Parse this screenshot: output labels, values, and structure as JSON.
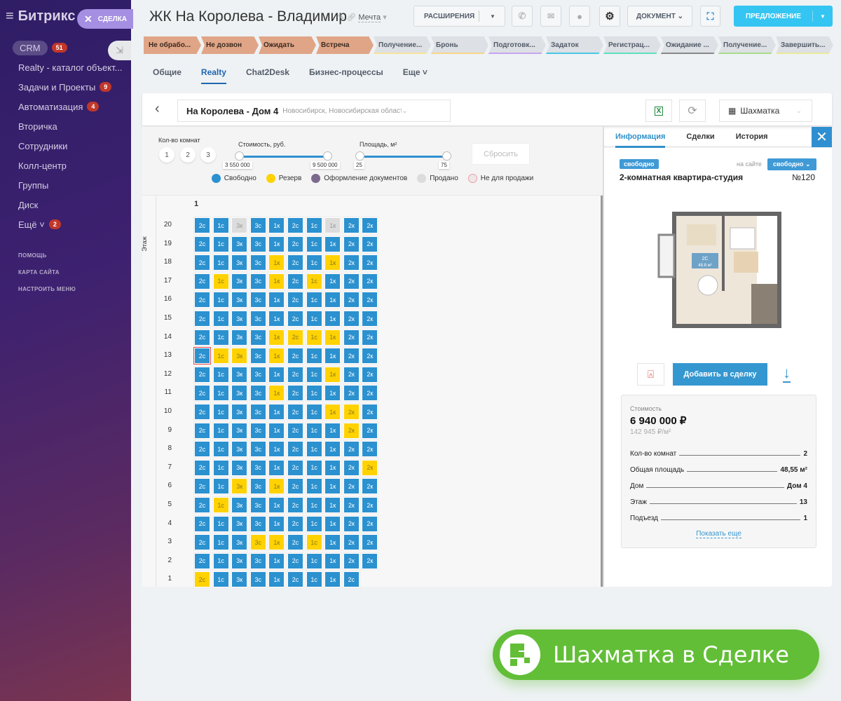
{
  "sidebar": {
    "logo": "Битрикс 24",
    "deal_pill": "СДЕЛКА",
    "items": [
      {
        "label": "CRM",
        "badge": "51"
      },
      {
        "label": "Realty - каталог объект...",
        "badge": null
      },
      {
        "label": "Задачи и Проекты",
        "badge": "9"
      },
      {
        "label": "Автоматизация",
        "badge": "4"
      },
      {
        "label": "Вторичка",
        "badge": null
      },
      {
        "label": "Сотрудники",
        "badge": null
      },
      {
        "label": "Колл-центр",
        "badge": null
      },
      {
        "label": "Группы",
        "badge": null
      },
      {
        "label": "Диск",
        "badge": null
      },
      {
        "label": "Ещё ˅",
        "badge": "2"
      }
    ],
    "links": [
      "ПОМОЩЬ",
      "КАРТА САЙТА",
      "НАСТРОИТЬ МЕНЮ"
    ]
  },
  "header": {
    "title": "ЖК На Королева - Владимир",
    "funnel": "Мечта",
    "extensions": "РАСШИРЕНИЯ",
    "document": "ДОКУМЕНТ",
    "proposal": "ПРЕДЛОЖЕНИЕ"
  },
  "stages": [
    {
      "label": "Не обрабо...",
      "color": "#e0a587",
      "done": true
    },
    {
      "label": "Не дозвон",
      "color": "#e0a587",
      "done": true
    },
    {
      "label": "Ожидать",
      "color": "#e0a587",
      "done": true
    },
    {
      "label": "Встреча",
      "color": "#e0a587",
      "done": true
    },
    {
      "label": "Получение...",
      "color": "#f7e49a",
      "done": false
    },
    {
      "label": "Бронь",
      "color": "#f7d58a",
      "done": false
    },
    {
      "label": "Подготовк...",
      "color": "#c7a5f0",
      "done": false
    },
    {
      "label": "Задаток",
      "color": "#47c8e6",
      "done": false
    },
    {
      "label": "Регистрац...",
      "color": "#5fe0c0",
      "done": false
    },
    {
      "label": "Ожидание ...",
      "color": "#888888",
      "done": false
    },
    {
      "label": "Получение...",
      "color": "#a7dc8a",
      "done": false
    },
    {
      "label": "Завершить...",
      "color": "#e8ec9a",
      "done": false
    }
  ],
  "tabs": [
    {
      "label": "Общие",
      "active": false
    },
    {
      "label": "Realty",
      "active": true
    },
    {
      "label": "Chat2Desk",
      "active": false
    },
    {
      "label": "Бизнес-процессы",
      "active": false
    },
    {
      "label": "Еще ˅",
      "active": false
    }
  ],
  "building": {
    "name": "На Королева - Дом 4",
    "address": "Новосибирск, Новосибирская область переулок",
    "view": "Шахматка"
  },
  "filters": {
    "rooms_label": "Кол-во комнат",
    "rooms": [
      "1",
      "2",
      "3"
    ],
    "price_label": "Стоимость, руб.",
    "price_min": "3 550 000",
    "price_max": "9 500 000",
    "area_label": "Площадь, м²",
    "area_min": "25",
    "area_max": "75",
    "reset": "Сбросить"
  },
  "legend": [
    {
      "label": "Свободно",
      "color": "#2b91cf"
    },
    {
      "label": "Резерв",
      "color": "#ffd200"
    },
    {
      "label": "Оформление документов",
      "color": "#7c6a8e"
    },
    {
      "label": "Продано",
      "color": "#dcdcdc"
    },
    {
      "label": "Не для продажи",
      "color": "#f0e6e8"
    }
  ],
  "grid": {
    "entrance": "1",
    "floor_axis": "Этаж",
    "selected": {
      "floor": "13",
      "index": 0
    },
    "floors": [
      {
        "floor": "20",
        "labels": [
          "2с",
          "1с",
          "3к",
          "3с",
          "1к",
          "2с",
          "1с",
          "1к",
          "2к",
          "2к"
        ],
        "status": [
          "free",
          "free",
          "sold",
          "free",
          "free",
          "free",
          "free",
          "sold",
          "free",
          "free"
        ]
      },
      {
        "floor": "19",
        "labels": [
          "2с",
          "1с",
          "3к",
          "3с",
          "1к",
          "2с",
          "1с",
          "1к",
          "2к",
          "2к"
        ],
        "status": [
          "free",
          "free",
          "free",
          "free",
          "free",
          "free",
          "free",
          "free",
          "free",
          "free"
        ]
      },
      {
        "floor": "18",
        "labels": [
          "2с",
          "1с",
          "3к",
          "3с",
          "1к",
          "2с",
          "1с",
          "1к",
          "2к",
          "2к"
        ],
        "status": [
          "free",
          "free",
          "free",
          "free",
          "reserve",
          "free",
          "free",
          "reserve",
          "free",
          "free"
        ]
      },
      {
        "floor": "17",
        "labels": [
          "2с",
          "1с",
          "3к",
          "3с",
          "1к",
          "2с",
          "1с",
          "1к",
          "2к",
          "2к"
        ],
        "status": [
          "free",
          "reserve",
          "free",
          "free",
          "reserve",
          "free",
          "reserve",
          "free",
          "free",
          "free"
        ]
      },
      {
        "floor": "16",
        "labels": [
          "2с",
          "1с",
          "3к",
          "3с",
          "1к",
          "2с",
          "1с",
          "1к",
          "2к",
          "2к"
        ],
        "status": [
          "free",
          "free",
          "free",
          "free",
          "free",
          "free",
          "free",
          "free",
          "free",
          "free"
        ]
      },
      {
        "floor": "15",
        "labels": [
          "2с",
          "1с",
          "3к",
          "3с",
          "1к",
          "2с",
          "1с",
          "1к",
          "2к",
          "2к"
        ],
        "status": [
          "free",
          "free",
          "free",
          "free",
          "free",
          "free",
          "free",
          "free",
          "free",
          "free"
        ]
      },
      {
        "floor": "14",
        "labels": [
          "2с",
          "1с",
          "3к",
          "3с",
          "1к",
          "2с",
          "1с",
          "1к",
          "2к",
          "2к"
        ],
        "status": [
          "free",
          "free",
          "free",
          "free",
          "reserve",
          "reserve",
          "reserve",
          "reserve",
          "free",
          "free"
        ]
      },
      {
        "floor": "13",
        "labels": [
          "2с",
          "1с",
          "3к",
          "3с",
          "1к",
          "2с",
          "1с",
          "1к",
          "2к",
          "2к"
        ],
        "status": [
          "free",
          "reserve",
          "reserve",
          "free",
          "reserve",
          "free",
          "free",
          "free",
          "free",
          "free"
        ]
      },
      {
        "floor": "12",
        "labels": [
          "2с",
          "1с",
          "3к",
          "3с",
          "1к",
          "2с",
          "1с",
          "1к",
          "2к",
          "2к"
        ],
        "status": [
          "free",
          "free",
          "free",
          "free",
          "free",
          "free",
          "free",
          "reserve",
          "free",
          "free"
        ]
      },
      {
        "floor": "11",
        "labels": [
          "2с",
          "1с",
          "3к",
          "3с",
          "1к",
          "2с",
          "1с",
          "1к",
          "2к",
          "2к"
        ],
        "status": [
          "free",
          "free",
          "free",
          "free",
          "reserve",
          "free",
          "free",
          "free",
          "free",
          "free"
        ]
      },
      {
        "floor": "10",
        "labels": [
          "2с",
          "1с",
          "3к",
          "3с",
          "1к",
          "2с",
          "1с",
          "1к",
          "2к",
          "2к"
        ],
        "status": [
          "free",
          "free",
          "free",
          "free",
          "free",
          "free",
          "free",
          "reserve",
          "reserve",
          "free"
        ]
      },
      {
        "floor": "9",
        "labels": [
          "2с",
          "1с",
          "3к",
          "3с",
          "1к",
          "2с",
          "1с",
          "1к",
          "2к",
          "2к"
        ],
        "status": [
          "free",
          "free",
          "free",
          "free",
          "free",
          "free",
          "free",
          "free",
          "reserve",
          "free"
        ]
      },
      {
        "floor": "8",
        "labels": [
          "2с",
          "1с",
          "3к",
          "3с",
          "1к",
          "2с",
          "1с",
          "1к",
          "2к",
          "2к"
        ],
        "status": [
          "free",
          "free",
          "free",
          "free",
          "free",
          "free",
          "free",
          "free",
          "free",
          "free"
        ]
      },
      {
        "floor": "7",
        "labels": [
          "2с",
          "1с",
          "3к",
          "3с",
          "1к",
          "2с",
          "1с",
          "1к",
          "2к",
          "2к"
        ],
        "status": [
          "free",
          "free",
          "free",
          "free",
          "free",
          "free",
          "free",
          "free",
          "free",
          "reserve"
        ]
      },
      {
        "floor": "6",
        "labels": [
          "2с",
          "1с",
          "3к",
          "3с",
          "1к",
          "2с",
          "1с",
          "1к",
          "2к",
          "2к"
        ],
        "status": [
          "free",
          "free",
          "reserve",
          "free",
          "reserve",
          "free",
          "free",
          "free",
          "free",
          "free"
        ]
      },
      {
        "floor": "5",
        "labels": [
          "2с",
          "1с",
          "3к",
          "3с",
          "1к",
          "2с",
          "1с",
          "1к",
          "2к",
          "2к"
        ],
        "status": [
          "free",
          "reserve",
          "free",
          "free",
          "free",
          "free",
          "free",
          "free",
          "free",
          "free"
        ]
      },
      {
        "floor": "4",
        "labels": [
          "2с",
          "1с",
          "3к",
          "3с",
          "1к",
          "2с",
          "1с",
          "1к",
          "2к",
          "2к"
        ],
        "status": [
          "free",
          "free",
          "free",
          "free",
          "free",
          "free",
          "free",
          "free",
          "free",
          "free"
        ]
      },
      {
        "floor": "3",
        "labels": [
          "2с",
          "1с",
          "3к",
          "3с",
          "1к",
          "2с",
          "1с",
          "1к",
          "2к",
          "2к"
        ],
        "status": [
          "free",
          "free",
          "free",
          "reserve",
          "reserve",
          "free",
          "reserve",
          "free",
          "free",
          "free"
        ]
      },
      {
        "floor": "2",
        "labels": [
          "2с",
          "1с",
          "3к",
          "3с",
          "1к",
          "2с",
          "1с",
          "1к",
          "2к",
          "2к"
        ],
        "status": [
          "free",
          "free",
          "free",
          "free",
          "free",
          "free",
          "free",
          "free",
          "free",
          "free"
        ]
      },
      {
        "floor": "1",
        "labels": [
          "2с",
          "1с",
          "3к",
          "3с",
          "1к",
          "2с",
          "1с",
          "1к",
          "2с"
        ],
        "status": [
          "reserve",
          "free",
          "free",
          "free",
          "free",
          "free",
          "free",
          "free",
          "free"
        ]
      }
    ]
  },
  "panel": {
    "tabs": [
      "Информация",
      "Сделки",
      "История"
    ],
    "status": "свободно",
    "site_label": "на сайте",
    "site_status": "свободно",
    "title": "2-комнатная квартира-студия",
    "number": "№120",
    "plan_label": "2С",
    "plan_area": "48.8 м²",
    "add_button": "Добавить в сделку",
    "price_label": "Стоимость",
    "price": "6 940 000 ₽",
    "price_per_m": "142 945 ₽/м²",
    "props": [
      {
        "k": "Кол-во комнат",
        "v": "2"
      },
      {
        "k": "Общая площадь",
        "v": "48,55 м²"
      },
      {
        "k": "Дом",
        "v": "Дом 4"
      },
      {
        "k": "Этаж",
        "v": "13"
      },
      {
        "k": "Подъезд",
        "v": "1"
      }
    ],
    "show_more": "Показать еще"
  },
  "banner": {
    "text": "Шахматка в Сделке",
    "color": "#62be37"
  }
}
